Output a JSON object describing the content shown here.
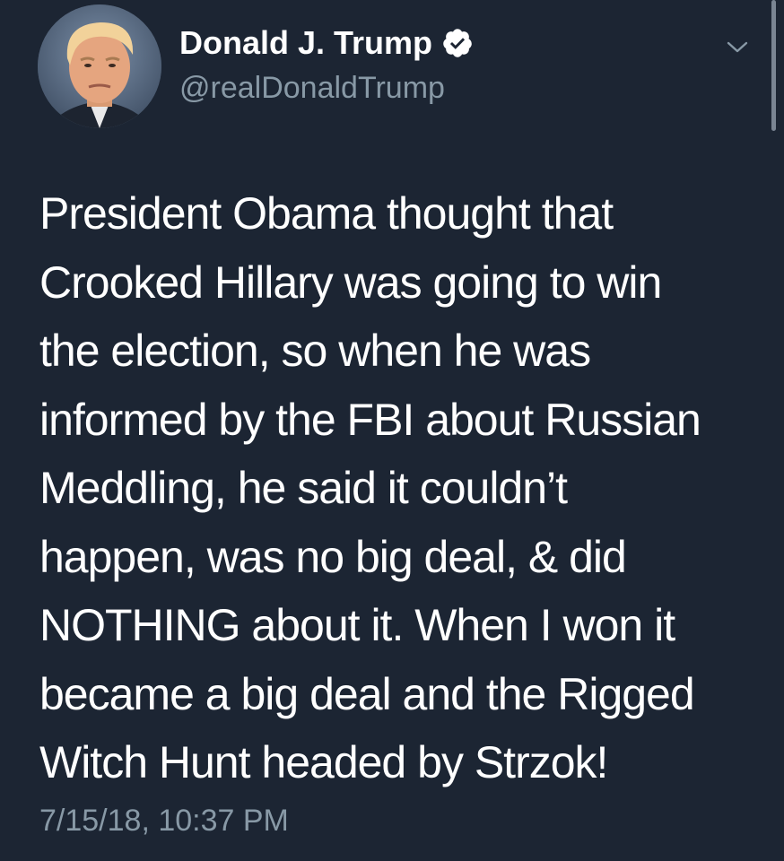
{
  "tweet": {
    "author": {
      "display_name": "Donald J. Trump",
      "handle": "@realDonaldTrump",
      "verified": true,
      "avatar_icon": "profile-photo",
      "verified_icon": "verified-badge-icon"
    },
    "text_lines": [
      "President Obama thought that",
      "Crooked Hillary was going to win",
      "the election, so when he was",
      "informed by the FBI about Russian",
      "Meddling, he said it couldn’t",
      "happen, was no big deal, & did",
      "NOTHING about it. When I won it",
      "became a big deal and the Rigged",
      "Witch Hunt headed by Strzok!"
    ],
    "timestamp": "7/15/18, 10:37 PM",
    "menu_icon": "chevron-down-icon"
  },
  "colors": {
    "background": "#1c2533",
    "primary_text": "#ffffff",
    "secondary_text": "#8899a6",
    "scrollbar": "#7a8593"
  }
}
